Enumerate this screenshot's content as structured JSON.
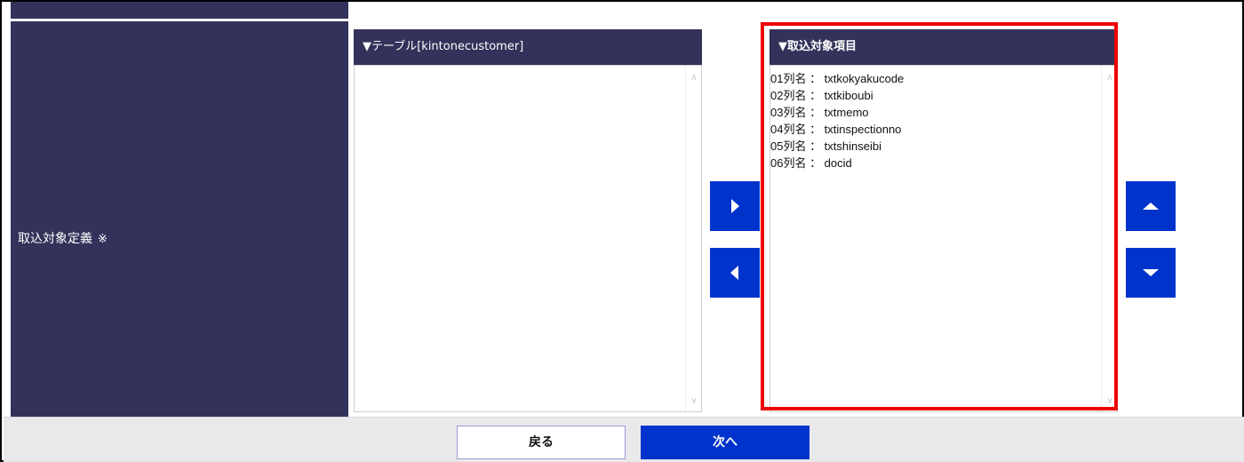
{
  "form": {
    "field_label": "取込対象定義",
    "required_mark": "※"
  },
  "source_panel": {
    "title": "▼テーブル[kintonecustomer]",
    "items": []
  },
  "target_panel": {
    "title": "▼取込対象項目",
    "items": [
      "01列名 ： txtkokyakucode",
      "02列名 ： txtkiboubi",
      "03列名 ： txtmemo",
      "04列名 ： txtinspectionno",
      "05列名 ： txtshinseibi",
      "06列名 ： docid"
    ]
  },
  "buttons": {
    "add_icon": "caret-right-icon",
    "remove_icon": "caret-left-icon",
    "move_up_icon": "caret-up-icon",
    "move_down_icon": "caret-down-icon",
    "back_label": "戻る",
    "next_label": "次へ"
  },
  "colors": {
    "header_navy": "#32325a",
    "button_blue": "#0033cc",
    "highlight_red": "#ee0000",
    "footer_gray": "#e9e9ec"
  }
}
